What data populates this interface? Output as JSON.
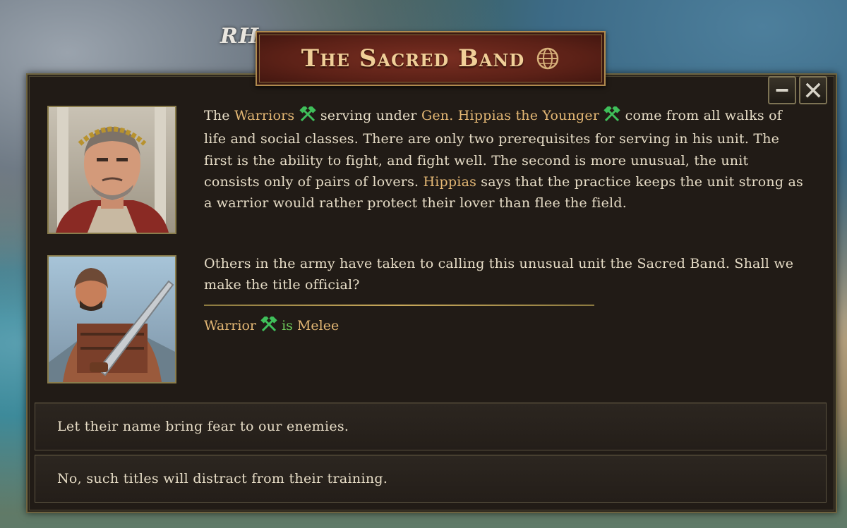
{
  "map": {
    "region_label": "RH"
  },
  "dialog": {
    "title": "The Sacred Band",
    "icons": {
      "title": "globe-icon",
      "unit": "crossed-hammers-icon"
    },
    "colors": {
      "highlight": "#e3b774",
      "unit_icon": "#3fbf5a",
      "melee_is": "#6ec95a"
    },
    "window_buttons": {
      "minimize": "minimize-icon",
      "close": "close-icon"
    },
    "paragraph1": {
      "t1": "The ",
      "unit": "Warriors",
      "t2": " serving under ",
      "general_title": "Gen.",
      "general_name": "Hippias the Younger",
      "t3": " come from all walks of life and social classes. There are only two prerequisites for serving in his unit. The first is the ability to fight, and fight well. The second is more unusual, the unit consists only of pairs of lovers. ",
      "name2": "Hippias",
      "t4": " says that the practice keeps the unit strong as a warrior would rather protect their lover than flee the field."
    },
    "paragraph2": "Others in the army have taken to calling this unusual unit the Sacred Band. Shall we make the title official?",
    "unit_info": {
      "unit": "Warrior",
      "is": "is",
      "type": "Melee"
    },
    "choices": [
      {
        "label": "Let their name bring fear to our enemies."
      },
      {
        "label": "No, such titles will distract from their training."
      }
    ]
  }
}
